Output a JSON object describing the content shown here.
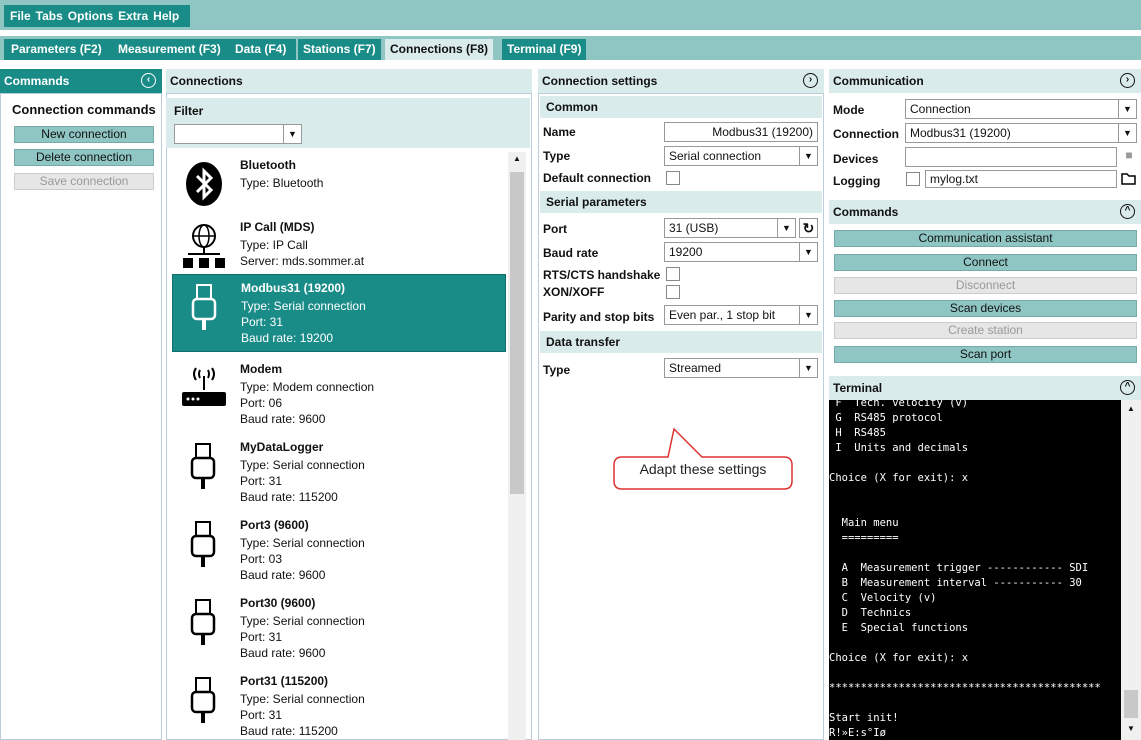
{
  "menu": {
    "items": [
      "File",
      "Tabs",
      "Options",
      "Extra",
      "Help"
    ]
  },
  "tabs": [
    "Parameters (F2)",
    "Measurement (F3)",
    "Data (F4)",
    "Stations (F7)",
    "Connections (F8)",
    "Terminal (F9)"
  ],
  "commands": {
    "title": "Commands",
    "section": "Connection commands",
    "buttons": [
      "New connection",
      "Delete connection",
      "Save connection"
    ]
  },
  "connections": {
    "title": "Connections",
    "filter_label": "Filter",
    "filter_value": "",
    "items": [
      {
        "name": "Bluetooth",
        "lines": [
          "Type: Bluetooth"
        ],
        "icon": "bluetooth-icon"
      },
      {
        "name": "IP Call (MDS)",
        "lines": [
          "Type: IP Call",
          "Server: mds.sommer.at"
        ],
        "icon": "network-globe-icon"
      },
      {
        "name": "Modbus31 (19200)",
        "lines": [
          "Type: Serial connection",
          "Port: 31",
          "Baud rate: 19200"
        ],
        "icon": "usb-icon"
      },
      {
        "name": "Modem",
        "lines": [
          "Type: Modem connection",
          "Port: 06",
          "Baud rate: 9600"
        ],
        "icon": "modem-icon"
      },
      {
        "name": "MyDataLogger",
        "lines": [
          "Type: Serial connection",
          "Port: 31",
          "Baud rate: 115200"
        ],
        "icon": "usb-icon"
      },
      {
        "name": "Port3 (9600)",
        "lines": [
          "Type: Serial connection",
          "Port: 03",
          "Baud rate: 9600"
        ],
        "icon": "usb-icon"
      },
      {
        "name": "Port30 (9600)",
        "lines": [
          "Type: Serial connection",
          "Port: 31",
          "Baud rate: 9600"
        ],
        "icon": "usb-icon"
      },
      {
        "name": "Port31 (115200)",
        "lines": [
          "Type: Serial connection",
          "Port: 31",
          "Baud rate: 115200"
        ],
        "icon": "usb-icon"
      }
    ]
  },
  "settings": {
    "title": "Connection settings",
    "common": "Common",
    "name_label": "Name",
    "name_value": "Modbus31 (19200)",
    "type_label": "Type",
    "type_value": "Serial connection",
    "default_label": "Default connection",
    "serial": "Serial parameters",
    "port_label": "Port",
    "port_value": "31 (USB)",
    "baud_label": "Baud rate",
    "baud_value": "19200",
    "rts_label": "RTS/CTS handshake",
    "xon_label": "XON/XOFF",
    "parity_label": "Parity and stop bits",
    "parity_value": "Even par., 1 stop bit",
    "transfer": "Data transfer",
    "transfer_type_label": "Type",
    "transfer_type_value": "Streamed",
    "callout": "Adapt these settings"
  },
  "communication": {
    "title": "Communication",
    "mode_label": "Mode",
    "mode_value": "Connection",
    "connection_label": "Connection",
    "connection_value": "Modbus31 (19200)",
    "devices_label": "Devices",
    "devices_value": "",
    "logging_label": "Logging",
    "logging_value": "mylog.txt"
  },
  "right_commands": {
    "title": "Commands",
    "buttons": [
      "Communication assistant",
      "Connect",
      "Disconnect",
      "Scan devices",
      "Create station",
      "Scan port"
    ]
  },
  "terminal": {
    "title": "Terminal",
    "lines": [
      " F  Tech. velocity (v)",
      " G  RS485 protocol",
      " H  RS485",
      " I  Units and decimals",
      "",
      "Choice (X for exit): x",
      "",
      "",
      "  Main menu",
      "  =========",
      "",
      "  A  Measurement trigger ------------ SDI",
      "  B  Measurement interval ----------- 30",
      "  C  Velocity (v)",
      "  D  Technics",
      "  E  Special functions",
      "",
      "Choice (X for exit): x",
      "",
      "*******************************************",
      "",
      "Start init!",
      "R!»E:s°Iø"
    ]
  }
}
